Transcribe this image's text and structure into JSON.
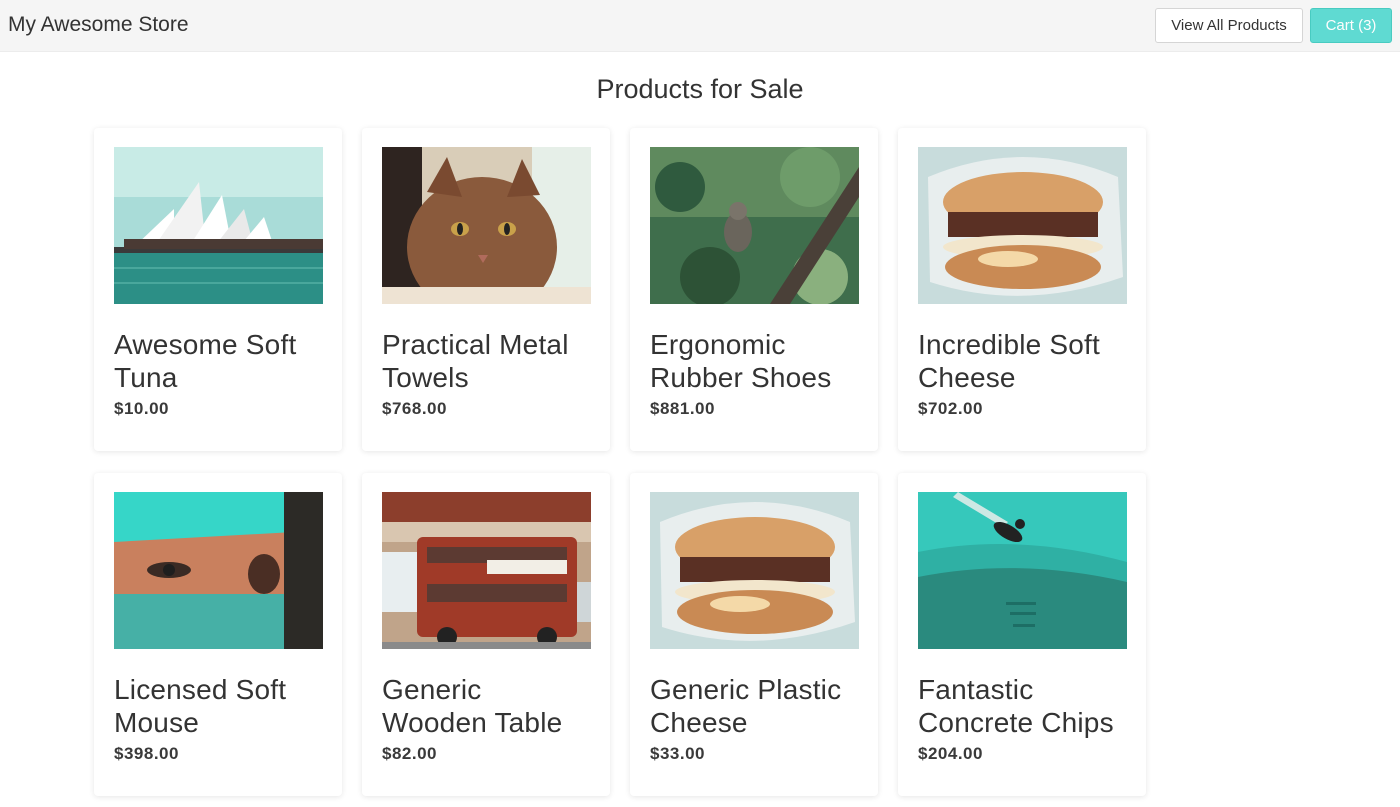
{
  "header": {
    "brand": "My Awesome Store",
    "view_all_label": "View All Products",
    "cart_label": "Cart (3)"
  },
  "main": {
    "title": "Products for Sale"
  },
  "products": [
    {
      "name": "Awesome Soft Tuna",
      "price": "$10.00",
      "image": "opera-house-photo"
    },
    {
      "name": "Practical Metal Towels",
      "price": "$768.00",
      "image": "cat-photo"
    },
    {
      "name": "Ergonomic Rubber Shoes",
      "price": "$881.00",
      "image": "monkey-in-forest-photo"
    },
    {
      "name": "Incredible Soft Cheese",
      "price": "$702.00",
      "image": "sandwich-photo"
    },
    {
      "name": "Licensed Soft Mouse",
      "price": "$398.00",
      "image": "surgeon-mask-photo"
    },
    {
      "name": "Generic Wooden Table",
      "price": "$82.00",
      "image": "double-decker-bus-photo"
    },
    {
      "name": "Generic Plastic Cheese",
      "price": "$33.00",
      "image": "sandwich-photo"
    },
    {
      "name": "Fantastic Concrete Chips",
      "price": "$204.00",
      "image": "surfer-photo"
    }
  ],
  "colors": {
    "accent": "#45d6cc",
    "navbar_bg": "#f5f5f5",
    "text": "#333333"
  }
}
